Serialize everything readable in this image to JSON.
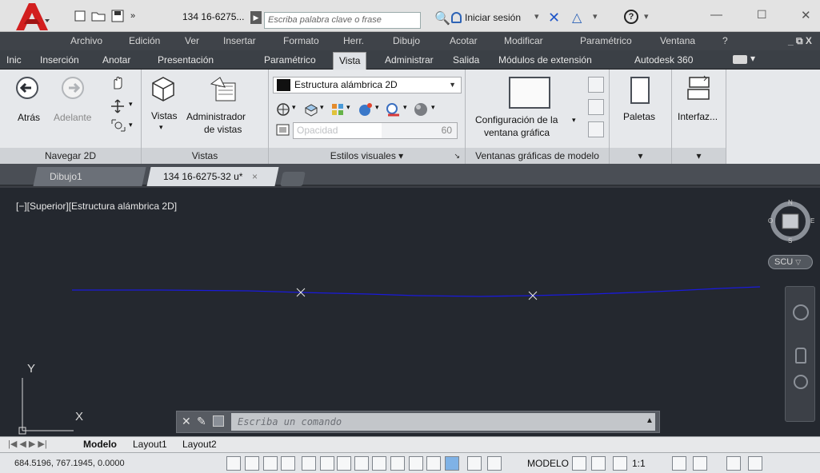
{
  "title_bar": {
    "app_menu_icon": "autocad-logo-icon",
    "qa_new_icon": "new-file-icon",
    "qa_open_icon": "open-folder-icon",
    "qa_save_icon": "save-disk-icon",
    "qa_more_icon": "double-chevron-icon",
    "document_title": "134 16-6275...",
    "search_placeholder": "Escriba palabra clave o frase",
    "signin_label": "Iniciar sesión",
    "help_label": "?"
  },
  "menu_bar": {
    "items": [
      "Archivo",
      "Edición",
      "Ver",
      "Insertar",
      "Formato",
      "Herr.",
      "Dibujo",
      "Acotar",
      "Modificar",
      "Paramétrico",
      "Ventana",
      "?"
    ],
    "window_controls": "_ ⧉ X"
  },
  "ribbon_tabs": {
    "items": [
      "Inic",
      "Inserción",
      "Anotar",
      "Presentación",
      "Paramétrico",
      "Vista",
      "Administrar",
      "Salida",
      "Módulos de extensión",
      "Autodesk 360"
    ],
    "active": "Vista"
  },
  "ribbon": {
    "navegar": {
      "title": "Navegar 2D",
      "back_label": "Atrás",
      "forward_label": "Adelante"
    },
    "vistas": {
      "title": "Vistas",
      "views_label": "Vistas",
      "manager_label_1": "Administrador",
      "manager_label_2": "de vistas"
    },
    "estilos": {
      "title": "Estilos visuales ▾",
      "visual_style": "Estructura alámbrica 2D",
      "opacity_label": "Opacidad",
      "opacity_value": "60",
      "launcher": "↘"
    },
    "ventanas": {
      "title": "Ventanas gráficas de modelo",
      "config_label_1": "Configuración de la",
      "config_label_2": "ventana gráfica"
    },
    "paletas": {
      "label": "Paletas",
      "title": "▾"
    },
    "interfaz": {
      "label": "Interfaz...",
      "title": "▾"
    }
  },
  "doc_tabs": [
    {
      "label": "Dibujo1",
      "active": false
    },
    {
      "label": "134 16-6275-32 u*",
      "active": true,
      "close": "×"
    }
  ],
  "viewport": {
    "label": "[−][Superior][Estructura alámbrica 2D]",
    "viewcube_top": "S",
    "viewcube_n": "N",
    "viewcube_o": "O",
    "viewcube_e": "E",
    "ucs_menu": "SCU",
    "y_axis": "Y",
    "x_axis": "X",
    "polyline_color": "#1a1adb",
    "marker_color": "#e8e8e8"
  },
  "command_line": {
    "placeholder": "Escriba un comando"
  },
  "layout_tabs": [
    "Modelo",
    "Layout1",
    "Layout2"
  ],
  "status_bar": {
    "coordinates": "684.5196, 767.1945, 0.0000",
    "model_label": "MODELO",
    "annotation_scale": "1:1"
  }
}
